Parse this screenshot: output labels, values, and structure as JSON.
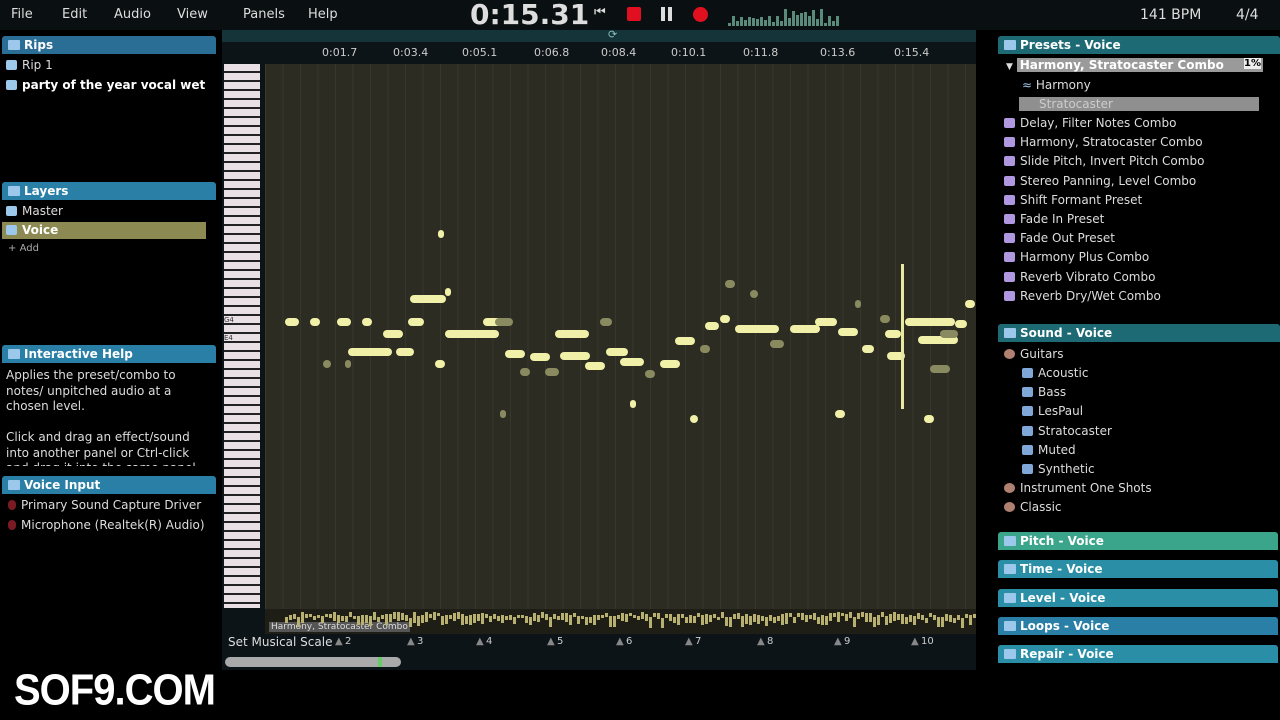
{
  "menu": [
    "File",
    "Edit",
    "Audio",
    "View",
    "Panels",
    "Help"
  ],
  "transport": {
    "time": "0:15.31",
    "bpm": "141 BPM",
    "signature": "4/4",
    "record_color": "#e01020"
  },
  "left": {
    "rips": {
      "title": "Rips",
      "items": [
        "Rip 1",
        "party of the year vocal wet"
      ]
    },
    "layers": {
      "title": "Layers",
      "items": [
        "Master",
        "Voice"
      ],
      "add": "Add"
    },
    "help": {
      "title": "Interactive Help",
      "text1": "Applies the preset/combo to notes/ unpitched audio at a chosen level.",
      "text2": "Click and drag an effect/sound into another panel or Ctrl-click and drag it into the same panel to"
    },
    "voice_input": {
      "title": "Voice Input",
      "items": [
        "Primary Sound Capture Driver",
        "Microphone (Realtek(R) Audio)"
      ]
    }
  },
  "ruler": [
    "0:01.7",
    "0:03.4",
    "0:05.1",
    "0:06.8",
    "0:08.4",
    "0:10.1",
    "0:11.8",
    "0:13.6",
    "0:15.4"
  ],
  "roll": {
    "note_labels": [
      "G4",
      "E4"
    ],
    "clip_label": "Harmony, Stratocaster Combo",
    "scale_button": "Set Musical Scale",
    "bars": [
      "2",
      "3",
      "4",
      "5",
      "6",
      "7",
      "8",
      "9",
      "10"
    ]
  },
  "right": {
    "presets": {
      "title": "Presets - Voice",
      "selected": "Harmony, Stratocaster Combo",
      "level": "1%",
      "sub": [
        "Harmony",
        "Stratocaster"
      ],
      "items": [
        "Delay, Filter Notes Combo",
        "Harmony, Stratocaster Combo",
        "Slide Pitch, Invert Pitch Combo",
        "Stereo Panning, Level Combo",
        "Shift Formant Preset",
        "Fade In Preset",
        "Fade Out Preset",
        "Harmony Plus Combo",
        "Reverb Vibrato Combo",
        "Reverb Dry/Wet Combo"
      ]
    },
    "sound": {
      "title": "Sound - Voice",
      "group": "Guitars",
      "items": [
        "Acoustic",
        "Bass",
        "LesPaul",
        "Stratocaster",
        "Muted",
        "Synthetic"
      ],
      "others": [
        "Instrument One Shots",
        "Classic"
      ]
    },
    "collapsed": [
      {
        "title": "Pitch - Voice",
        "color": "#3aa58a"
      },
      {
        "title": "Time - Voice",
        "color": "#2a8fa6"
      },
      {
        "title": "Level - Voice",
        "color": "#2a8fa6"
      },
      {
        "title": "Loops - Voice",
        "color": "#2a7fa6"
      },
      {
        "title": "Repair - Voice",
        "color": "#2a8fa6"
      }
    ]
  },
  "watermark": "SOF9.COM"
}
